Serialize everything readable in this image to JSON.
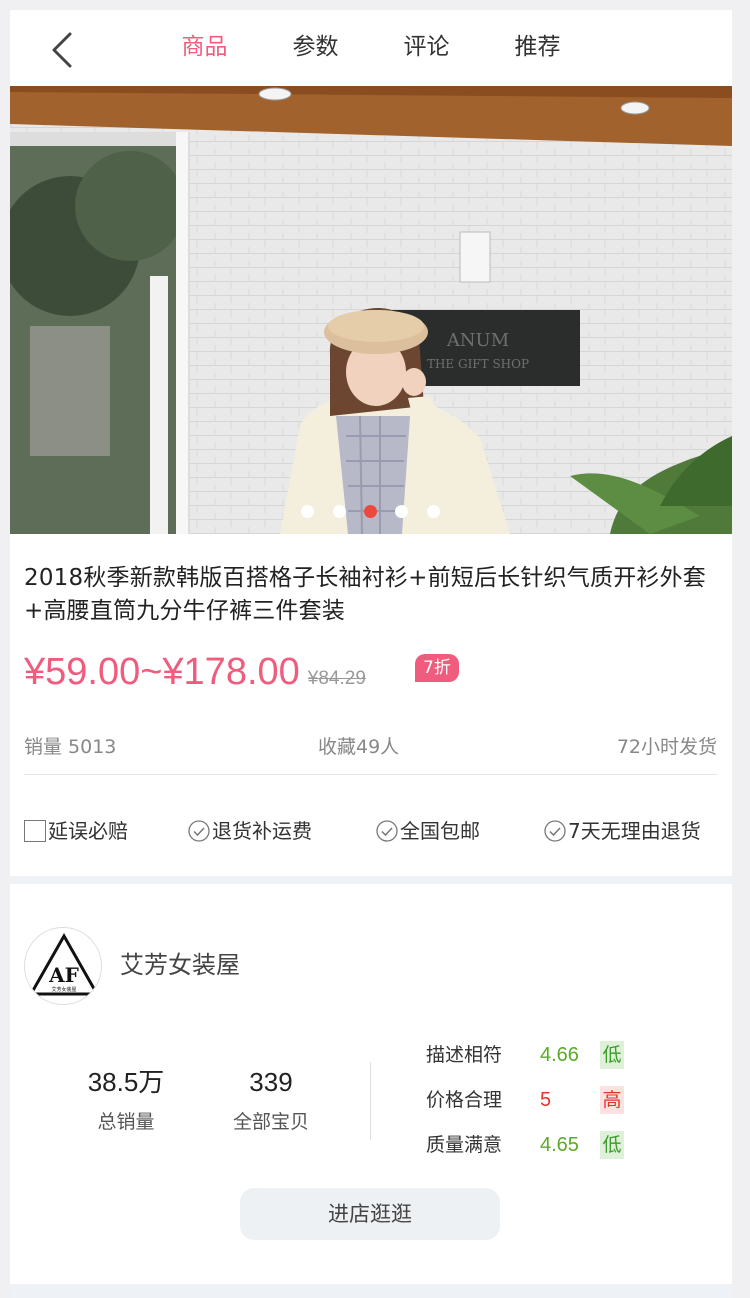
{
  "header": {
    "tabs": [
      {
        "label": "商品",
        "active": true
      },
      {
        "label": "参数",
        "active": false
      },
      {
        "label": "评论",
        "active": false
      },
      {
        "label": "推荐",
        "active": false
      }
    ]
  },
  "hero": {
    "sign_text_line1": "ANUM",
    "sign_text_line2": "THE GIFT SHOP",
    "dot_count": 5,
    "active_dot": 3
  },
  "product": {
    "title": "2018秋季新款韩版百搭格子长袖衬衫+前短后长针织气质开衫外套+高腰直筒九分牛仔裤三件套装",
    "price": "¥59.00~¥178.00",
    "original_price": "¥84.29",
    "discount": "7折",
    "sales": "销量 5013",
    "favorites": "收藏49人",
    "shipping": "72小时发货"
  },
  "guarantees": [
    {
      "label": "延误必赔",
      "icon": "checkbox-icon"
    },
    {
      "label": "退货补运费",
      "icon": "check-circle-icon"
    },
    {
      "label": "全国包邮",
      "icon": "check-circle-icon"
    },
    {
      "label": "7天无理由退货",
      "icon": "check-circle-icon"
    }
  ],
  "shop": {
    "logo_text": "AF",
    "logo_subtext": "艾芳女装屋",
    "name": "艾芳女装屋",
    "total_sales": "38.5万",
    "total_sales_label": "总销量",
    "all_items": "339",
    "all_items_label": "全部宝贝",
    "ratings": [
      {
        "label": "描述相符",
        "score": "4.66",
        "level": "低"
      },
      {
        "label": "价格合理",
        "score": "5",
        "level": "高"
      },
      {
        "label": "质量满意",
        "score": "4.65",
        "level": "低"
      }
    ],
    "enter_label": "进店逛逛"
  },
  "colors": {
    "accent": "#f05c7d",
    "low": "#5aab28",
    "high": "#e0372b"
  }
}
